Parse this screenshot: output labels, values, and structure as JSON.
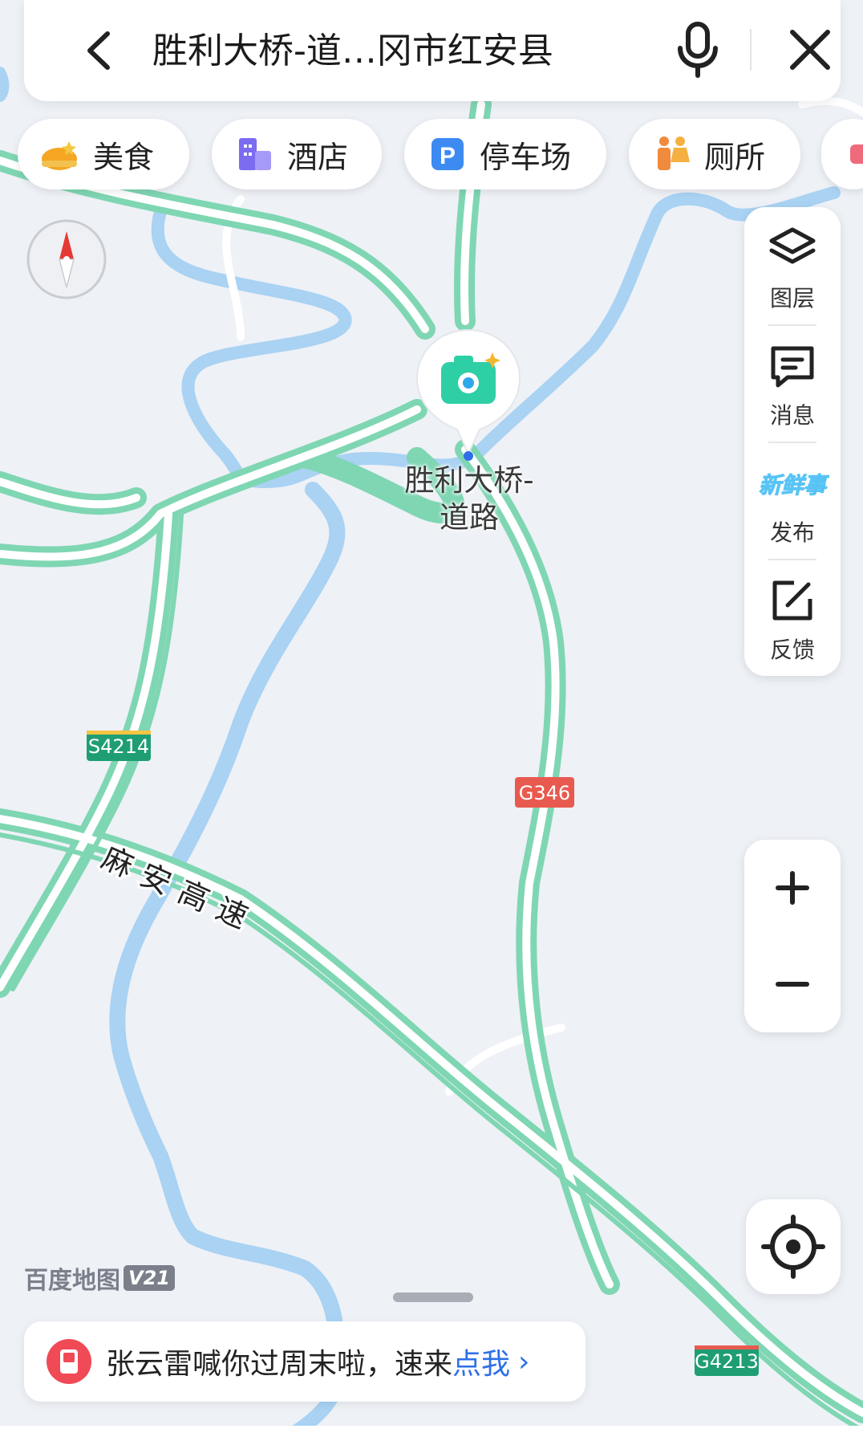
{
  "search": {
    "query": "胜利大桥-道…冈市红安县"
  },
  "categories": [
    {
      "label": "美食",
      "icon": "food-icon"
    },
    {
      "label": "酒店",
      "icon": "hotel-icon"
    },
    {
      "label": "停车场",
      "icon": "parking-icon"
    },
    {
      "label": "厕所",
      "icon": "toilet-icon"
    }
  ],
  "tools": [
    {
      "label": "图层",
      "icon": "layers-icon"
    },
    {
      "label": "消息",
      "icon": "message-icon"
    },
    {
      "label": "发布",
      "icon": "new-post-icon",
      "badge": "新鲜事"
    },
    {
      "label": "反馈",
      "icon": "feedback-icon"
    }
  ],
  "marker": {
    "label_line1": "胜利大桥-",
    "label_line2": "道路"
  },
  "road_labels": {
    "s4214": "S4214",
    "g346": "G346",
    "g4213": "G4213",
    "highway": "麻安高速"
  },
  "logo": {
    "text": "百度地图",
    "version": "V21"
  },
  "promo": {
    "text": "张云雷喊你过周末啦，速来",
    "link": "点我"
  },
  "colors": {
    "road_casing": "#7fd6b3",
    "water": "#a9d2f3",
    "land": "#eef1f6",
    "link_blue": "#2e6fe8",
    "national_road_sign": "#e85a4f",
    "expressway_sign": "#1f9e74"
  }
}
